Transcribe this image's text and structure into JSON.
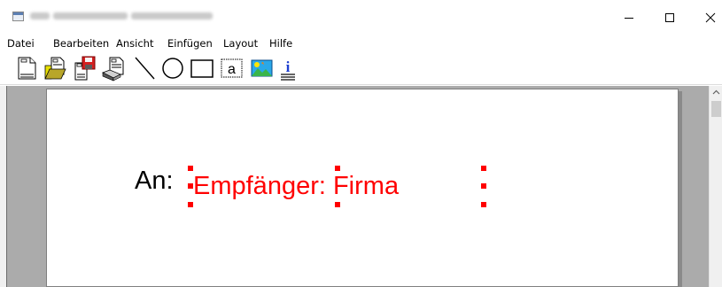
{
  "window": {
    "title_icon": "window-app-icon",
    "controls": [
      "minimize-icon",
      "maximize-icon",
      "close-icon"
    ]
  },
  "menu": {
    "items": [
      "Datei",
      "Bearbeiten",
      "Ansicht",
      "Einfügen",
      "Layout",
      "Hilfe"
    ]
  },
  "toolbar": {
    "tools": [
      "new-document-icon",
      "open-file-icon",
      "save-icon",
      "print-icon",
      "line-tool-icon",
      "ellipse-tool-icon",
      "rectangle-tool-icon",
      "text-field-icon",
      "image-icon",
      "info-data-field-icon"
    ],
    "text_tool_glyph": "a",
    "info_glyph": "i"
  },
  "document": {
    "label": "An:",
    "field_text": "Empfänger: Firma",
    "field_color": "#ff0000",
    "label_color": "#000000"
  },
  "colors": {
    "workspace": "#ababab",
    "page": "#ffffff",
    "selection_handles": "#ff0000"
  }
}
